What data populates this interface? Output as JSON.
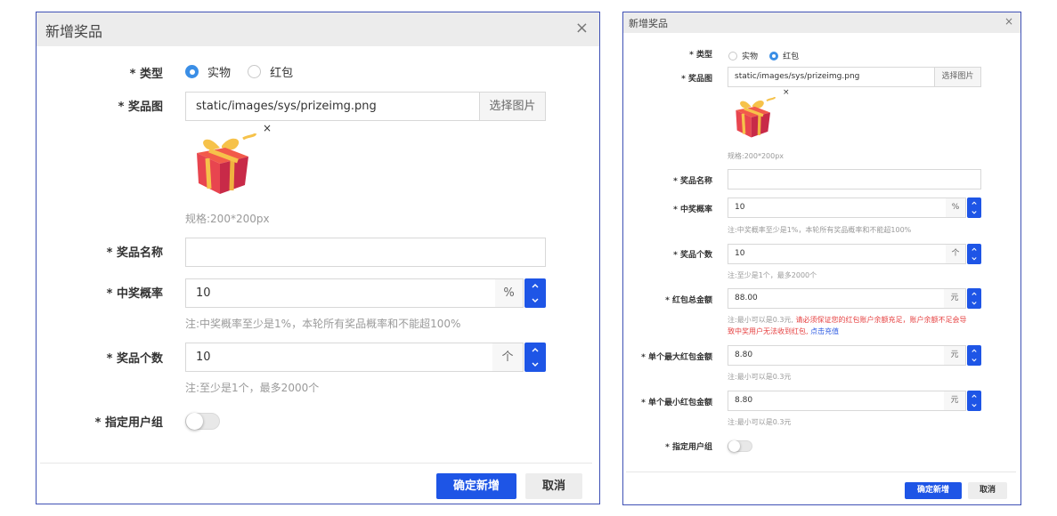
{
  "left_dialog": {
    "title": "新增奖品",
    "close": "×",
    "type": {
      "label": "* 类型",
      "options": [
        "实物",
        "红包"
      ],
      "selected": "实物"
    },
    "image": {
      "label": "* 奖品图",
      "value": "static/images/sys/prizeimg.png",
      "button": "选择图片",
      "remove": "×",
      "hint": "规格:200*200px"
    },
    "name": {
      "label": "* 奖品名称",
      "value": ""
    },
    "rate": {
      "label": "* 中奖概率",
      "value": "10",
      "unit": "%",
      "hint": "注:中奖概率至少是1%，本轮所有奖品概率和不能超100%"
    },
    "count": {
      "label": "* 奖品个数",
      "value": "10",
      "unit": "个",
      "hint": "注:至少是1个，最多2000个"
    },
    "group": {
      "label": "* 指定用户组",
      "enabled": false
    },
    "confirm": "确定新增",
    "cancel": "取消"
  },
  "right_dialog": {
    "title": "新增奖品",
    "close": "×",
    "type": {
      "label": "* 类型",
      "options": [
        "实物",
        "红包"
      ],
      "selected": "红包"
    },
    "image": {
      "label": "* 奖品图",
      "value": "static/images/sys/prizeimg.png",
      "button": "选择图片",
      "remove": "×",
      "hint": "规格:200*200px"
    },
    "name": {
      "label": "* 奖品名称",
      "value": ""
    },
    "rate": {
      "label": "* 中奖概率",
      "value": "10",
      "unit": "%",
      "hint": "注:中奖概率至少是1%，本轮所有奖品概率和不能超100%"
    },
    "count": {
      "label": "* 奖品个数",
      "value": "10",
      "unit": "个",
      "hint": "注:至少是1个，最多2000个"
    },
    "total": {
      "label": "* 红包总金额",
      "value": "88.00",
      "unit": "元",
      "hint_gray": "注:最小可以是0.3元,",
      "hint_red": " 请必须保证您的红包账户余额充足，账户余额不足会导",
      "hint_red2": "致中奖用户无法收到红包,",
      "hint_link": " 点击充值"
    },
    "max": {
      "label": "* 单个最大红包金额",
      "value": "8.80",
      "unit": "元",
      "hint": "注:最小可以是0.3元"
    },
    "min": {
      "label": "* 单个最小红包金额",
      "value": "8.80",
      "unit": "元",
      "hint": "注:最小可以是0.3元"
    },
    "group": {
      "label": "* 指定用户组",
      "enabled": false
    },
    "confirm": "确定新增",
    "cancel": "取消"
  },
  "colors": {
    "primary": "#1e55e6",
    "radio_on": "#3a8ee6",
    "hint_red": "#e64040",
    "link": "#2d5be3"
  }
}
